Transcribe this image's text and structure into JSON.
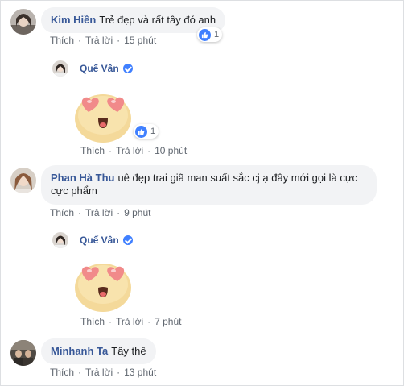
{
  "comments": [
    {
      "author": "Kim Hiền",
      "text": "Trẻ đẹp và rất tây đó anh",
      "like_label": "Thích",
      "reply_label": "Trả lời",
      "time": "15 phút",
      "like_count": "1",
      "reply": {
        "author": "Quế Vân",
        "like_label": "Thích",
        "reply_label": "Trả lời",
        "time": "10 phút",
        "like_count": "1"
      }
    },
    {
      "author": "Phan Hà Thu",
      "text_line1": "uê đẹp trai giã man suất sắc cj ạ đây mới gọi là cực",
      "text_line2": "cực phẩm",
      "like_label": "Thích",
      "reply_label": "Trả lời",
      "time": "9 phút",
      "reply": {
        "author": "Quế Vân",
        "like_label": "Thích",
        "reply_label": "Trả lời",
        "time": "7 phút"
      }
    },
    {
      "author": "Minhanh Ta",
      "text": "Tây thế",
      "like_label": "Thích",
      "reply_label": "Trả lời",
      "time": "13 phút"
    }
  ],
  "separator": "·",
  "icons": {
    "verified": "verified-badge-icon",
    "like": "thumbs-up-icon",
    "sticker": "heart-eyes-emoji-sticker"
  },
  "colors": {
    "author": "#385898",
    "bubble": "#f2f3f5",
    "meta": "#606770",
    "verified": "#4080ff"
  }
}
